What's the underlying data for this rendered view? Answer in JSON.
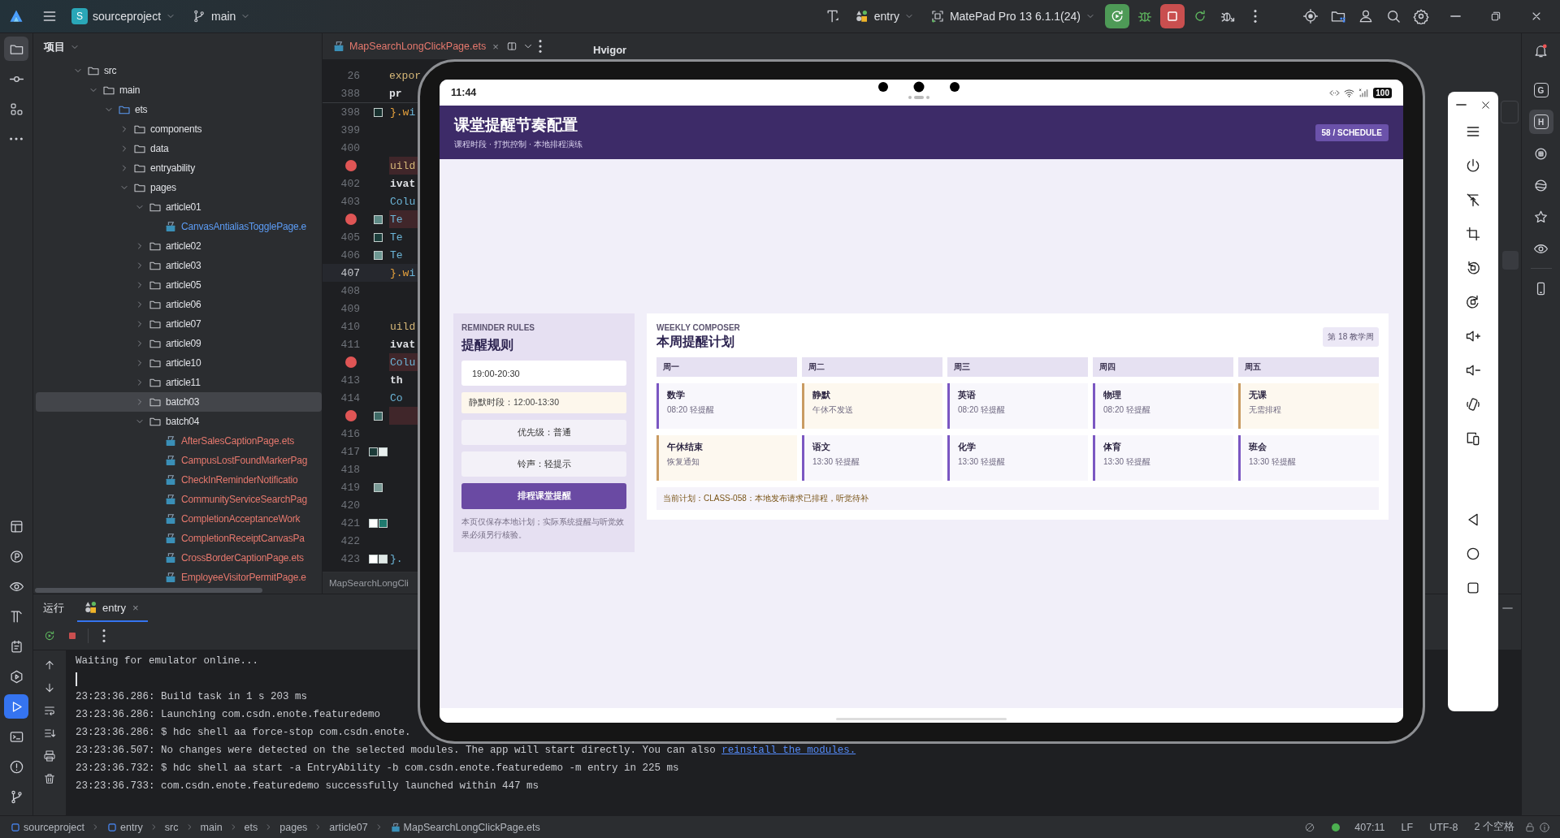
{
  "title_bar": {
    "project_badge": "S",
    "project": "sourceproject",
    "branch": "main",
    "run_config": "entry",
    "device": "MatePad Pro 13 6.1.1(24)"
  },
  "left_toolbar": {
    "top": [
      {
        "selected": true
      },
      {
        "selected": false
      },
      {
        "selected": false
      },
      {
        "selected": false
      }
    ],
    "bottom": [
      {
        "selected": false
      },
      {
        "selected": false
      },
      {
        "selected": false
      },
      {
        "selected": false
      },
      {
        "selected": false
      },
      {
        "selected": false
      },
      {
        "selected": true
      },
      {
        "selected": false
      },
      {
        "selected": false
      },
      {
        "selected": false
      }
    ]
  },
  "project_panel": {
    "title": "项目",
    "tree": [
      {
        "name": "src",
        "kind": "folder",
        "expanded": true,
        "selected": false,
        "children": [
          {
            "name": "main",
            "kind": "folder",
            "expanded": true,
            "selected": false,
            "children": [
              {
                "name": "ets",
                "kind": "source",
                "expanded": true,
                "selected": false,
                "children": [
                  {
                    "name": "components",
                    "kind": "folder",
                    "expanded": false,
                    "selected": false
                  },
                  {
                    "name": "data",
                    "kind": "folder",
                    "expanded": false,
                    "selected": false
                  },
                  {
                    "name": "entryability",
                    "kind": "folder",
                    "expanded": false,
                    "selected": false
                  },
                  {
                    "name": "pages",
                    "kind": "folder",
                    "expanded": true,
                    "selected": false,
                    "children": [
                      {
                        "name": "article01",
                        "kind": "folder",
                        "expanded": true,
                        "selected": false,
                        "children": [
                          {
                            "name": "CanvasAntialiasTogglePage.e",
                            "kind": "file",
                            "selected": false,
                            "color": "#5c9cf5"
                          }
                        ]
                      },
                      {
                        "name": "article02",
                        "kind": "folder",
                        "expanded": false,
                        "selected": false
                      },
                      {
                        "name": "article03",
                        "kind": "folder",
                        "expanded": false,
                        "selected": false
                      },
                      {
                        "name": "article05",
                        "kind": "folder",
                        "expanded": false,
                        "selected": false
                      },
                      {
                        "name": "article06",
                        "kind": "folder",
                        "expanded": false,
                        "selected": false
                      },
                      {
                        "name": "article07",
                        "kind": "folder",
                        "expanded": false,
                        "selected": false
                      },
                      {
                        "name": "article09",
                        "kind": "folder",
                        "expanded": false,
                        "selected": false
                      },
                      {
                        "name": "article10",
                        "kind": "folder",
                        "expanded": false,
                        "selected": false
                      },
                      {
                        "name": "article11",
                        "kind": "folder",
                        "expanded": false,
                        "selected": false
                      },
                      {
                        "name": "batch03",
                        "kind": "folder",
                        "expanded": false,
                        "selected": true
                      },
                      {
                        "name": "batch04",
                        "kind": "folder",
                        "expanded": true,
                        "selected": false,
                        "children": [
                          {
                            "name": "AfterSalesCaptionPage.ets",
                            "kind": "file",
                            "selected": false,
                            "color": "#e5786d"
                          },
                          {
                            "name": "CampusLostFoundMarkerPag",
                            "kind": "file",
                            "selected": false,
                            "color": "#e5786d"
                          },
                          {
                            "name": "CheckInReminderNotificatio",
                            "kind": "file",
                            "selected": false,
                            "color": "#e5786d"
                          },
                          {
                            "name": "CommunityServiceSearchPag",
                            "kind": "file",
                            "selected": false,
                            "color": "#e5786d"
                          },
                          {
                            "name": "CompletionAcceptanceWork",
                            "kind": "file",
                            "selected": false,
                            "color": "#e5786d"
                          },
                          {
                            "name": "CompletionReceiptCanvasPa",
                            "kind": "file",
                            "selected": false,
                            "color": "#e5786d"
                          },
                          {
                            "name": "CrossBorderCaptionPage.ets",
                            "kind": "file",
                            "selected": false,
                            "color": "#e5786d"
                          },
                          {
                            "name": "EmployeeVisitorPermitPage.e",
                            "kind": "file",
                            "selected": false,
                            "color": "#e5786d"
                          }
                        ]
                      }
                    ]
                  }
                ]
              }
            ]
          }
        ]
      }
    ]
  },
  "editor": {
    "tab": "MapSearchLongClickPage.ets",
    "tab_close": "×",
    "sticky": [
      {
        "number": "26",
        "code": "expor",
        "kind": "keyword"
      },
      {
        "number": "388",
        "code": "pr",
        "kind": "plain"
      }
    ],
    "lines": [
      {
        "number": "398",
        "code": "}.wi",
        "kind": "close",
        "breakpoint": false,
        "current": false,
        "swatches": [
          {
            "color": "#17302e"
          }
        ]
      },
      {
        "number": "399",
        "breakpoint": false,
        "current": false
      },
      {
        "number": "400",
        "breakpoint": false,
        "current": false
      },
      {
        "code": "uild",
        "kind": "keyword",
        "breakpoint": true,
        "current": false
      },
      {
        "number": "402",
        "code": "ivat",
        "kind": "plain",
        "breakpoint": false,
        "current": false
      },
      {
        "number": "403",
        "code": "Colu",
        "kind": "type",
        "breakpoint": false,
        "current": false
      },
      {
        "code": "Te",
        "kind": "type",
        "breakpoint": true,
        "current": false,
        "swatches": [
          {
            "color": "#5e8a86"
          }
        ]
      },
      {
        "number": "405",
        "code": "Te",
        "kind": "type",
        "breakpoint": false,
        "current": false,
        "swatches": [
          {
            "color": "#1d3f3c"
          }
        ]
      },
      {
        "number": "406",
        "code": "Te",
        "kind": "type",
        "breakpoint": false,
        "current": false,
        "swatches": [
          {
            "color": "#6e9893"
          }
        ]
      },
      {
        "number": "407",
        "code": "}.wi",
        "kind": "close",
        "breakpoint": false,
        "current": true
      },
      {
        "number": "408",
        "breakpoint": false,
        "current": false
      },
      {
        "number": "409",
        "breakpoint": false,
        "current": false
      },
      {
        "number": "410",
        "code": "uild",
        "kind": "keyword",
        "breakpoint": false,
        "current": false
      },
      {
        "number": "411",
        "code": "ivat",
        "kind": "plain",
        "breakpoint": false,
        "current": false
      },
      {
        "code": "Colu",
        "kind": "type",
        "breakpoint": true,
        "current": false
      },
      {
        "number": "413",
        "code": "th",
        "kind": "plain",
        "breakpoint": false,
        "current": false
      },
      {
        "number": "414",
        "code": "Co",
        "kind": "type",
        "breakpoint": false,
        "current": false
      },
      {
        "breakpoint": true,
        "current": false,
        "swatches": [
          {
            "color": "#3f6b67"
          }
        ]
      },
      {
        "number": "416",
        "breakpoint": false,
        "current": false
      },
      {
        "number": "417",
        "breakpoint": false,
        "current": false,
        "swatches": [
          {
            "color": "#1b3a38"
          },
          {
            "color": "#e8eeee"
          }
        ]
      },
      {
        "number": "418",
        "breakpoint": false,
        "current": false
      },
      {
        "number": "419",
        "breakpoint": false,
        "current": false,
        "swatches": [
          {
            "color": "#7a9a96"
          }
        ]
      },
      {
        "number": "420",
        "breakpoint": false,
        "current": false
      },
      {
        "number": "421",
        "breakpoint": false,
        "current": false,
        "swatches": [
          {
            "color": "#ffffff"
          },
          {
            "color": "#1f7a6e"
          }
        ]
      },
      {
        "number": "422",
        "breakpoint": false,
        "current": false
      },
      {
        "number": "423",
        "code": "}.",
        "kind": "close",
        "breakpoint": false,
        "current": false,
        "swatches": [
          {
            "color": "#ffffff"
          },
          {
            "color": "#dfe8e6"
          }
        ]
      }
    ],
    "breadcrumb": "MapSearchLongCli"
  },
  "hvigor": {
    "title": "Hvigor"
  },
  "emulator": {
    "time": "11:44",
    "battery": "100",
    "app": {
      "title": "课堂提醒节奏配置",
      "subtitle": "课程时段 · 打扰控制 · 本地排程演练",
      "badge": "58 / SCHEDULE",
      "rules": {
        "eyebrow": "REMINDER RULES",
        "title": "提醒规则",
        "time_value": "19:00-20:30",
        "quiet": "静默时段：12:00-13:30",
        "priority": "优先级：普通",
        "ringtone": "铃声：轻提示",
        "button": "排程课堂提醒",
        "note": "本页仅保存本地计划；实际系统提醒与听觉效果必须另行核验。"
      },
      "composer": {
        "eyebrow": "WEEKLY COMPOSER",
        "title": "本周提醒计划",
        "week": "第 18 教学周",
        "days": [
          "周一",
          "周二",
          "周三",
          "周四",
          "周五"
        ],
        "rows": [
          [
            {
              "title": "数学",
              "sub": "08:20 轻提醒",
              "kind": "class"
            },
            {
              "title": "静默",
              "sub": "午休不发送",
              "kind": "rest"
            },
            {
              "title": "英语",
              "sub": "08:20 轻提醒",
              "kind": "class"
            },
            {
              "title": "物理",
              "sub": "08:20 轻提醒",
              "kind": "class"
            },
            {
              "title": "无课",
              "sub": "无需排程",
              "kind": "rest"
            }
          ],
          [
            {
              "title": "午休结束",
              "sub": "恢复通知",
              "kind": "rest"
            },
            {
              "title": "语文",
              "sub": "13:30 轻提醒",
              "kind": "class"
            },
            {
              "title": "化学",
              "sub": "13:30 轻提醒",
              "kind": "class"
            },
            {
              "title": "体育",
              "sub": "13:30 轻提醒",
              "kind": "class"
            },
            {
              "title": "班会",
              "sub": "13:30 轻提醒",
              "kind": "class"
            }
          ]
        ],
        "status": "当前计划：CLASS-058：本地发布请求已排程，听觉待补"
      }
    }
  },
  "run_panel": {
    "title": "运行",
    "tabs": [
      {
        "label": "entry",
        "selected": true,
        "close": "×"
      }
    ],
    "console": [
      {
        "kind": "text",
        "text": "Waiting for emulator online..."
      },
      {
        "kind": "cursor"
      },
      {
        "kind": "text",
        "text": "23:23:36.286: Build task in 1 s 203 ms"
      },
      {
        "kind": "text",
        "text": "23:23:36.286: Launching com.csdn.enote.featuredemo"
      },
      {
        "kind": "text",
        "text": "23:23:36.286: $ hdc shell aa force-stop com.csdn.enote."
      },
      {
        "kind": "text",
        "text": "23:23:36.507: No changes were detected on the selected modules. The app will start directly. You can also ",
        "link": "reinstall the modules."
      },
      {
        "kind": "text",
        "text": "23:23:36.732: $ hdc shell aa start -a EntryAbility -b com.csdn.enote.featuredemo -m entry in 225 ms"
      },
      {
        "kind": "text",
        "text": "23:23:36.733: com.csdn.enote.featuredemo successfully launched within 447 ms"
      }
    ]
  },
  "right_toolbar": [
    {
      "selected": false
    },
    {
      "label": "G",
      "selected": false
    },
    {
      "label": "H",
      "selected": true
    },
    {
      "selected": false
    },
    {
      "selected": false
    },
    {
      "selected": false
    },
    {
      "selected": false
    },
    {
      "selected": false
    }
  ],
  "status_bar": {
    "breadcrumb": [
      "sourceproject",
      "entry",
      "src",
      "main",
      "ets",
      "pages",
      "article07",
      "MapSearchLongClickPage.ets"
    ],
    "position": "407:11",
    "line_ending": "LF",
    "encoding": "UTF-8",
    "indent": "2 个空格"
  }
}
